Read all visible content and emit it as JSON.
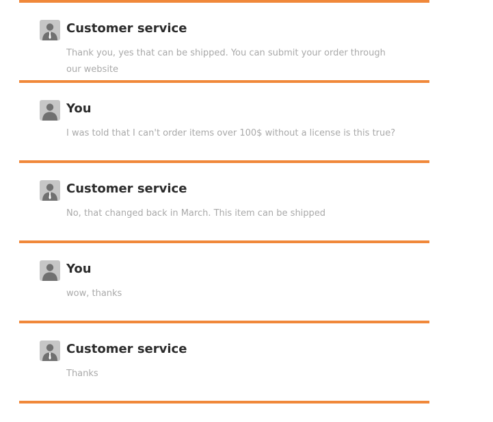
{
  "colors": {
    "accent": "#f0883a",
    "author_text": "#2b2b2b",
    "message_text": "#a9a9a9",
    "avatar_bg": "#c6c6c6"
  },
  "messages": [
    {
      "author": "Customer service",
      "avatar_icon": "business-person-icon",
      "text": "Thank you, yes that can be shipped. You can submit your order through our website"
    },
    {
      "author": "You",
      "avatar_icon": "person-icon",
      "text": "I was told that I can't order items over 100$ without a license is this true?"
    },
    {
      "author": "Customer service",
      "avatar_icon": "business-person-icon",
      "text": "No, that changed back in March. This item can be shipped"
    },
    {
      "author": "You",
      "avatar_icon": "person-icon",
      "text": "wow, thanks"
    },
    {
      "author": "Customer service",
      "avatar_icon": "business-person-icon",
      "text": "Thanks"
    }
  ]
}
